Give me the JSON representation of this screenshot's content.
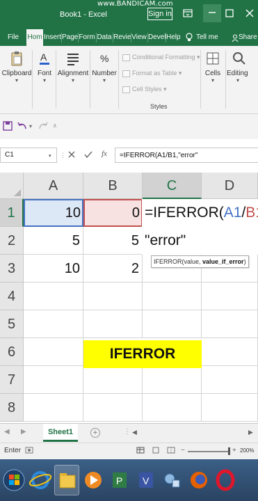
{
  "watermark": "www.BANDICAM.com",
  "window": {
    "title": "Book1 - Excel",
    "signin": "Sign in"
  },
  "tabs": [
    {
      "label": "File"
    },
    {
      "label": "Hom"
    },
    {
      "label": "Insert"
    },
    {
      "label": "Page"
    },
    {
      "label": "Form"
    },
    {
      "label": "Data"
    },
    {
      "label": "Revie"
    },
    {
      "label": "View"
    },
    {
      "label": "Devel"
    },
    {
      "label": "Help"
    }
  ],
  "tellme": "Tell me",
  "share": "Share",
  "ribbon": {
    "clipboard": "Clipboard",
    "font": "Font",
    "alignment": "Alignment",
    "number": "Number",
    "conditional_formatting": "Conditional Formatting",
    "format_as_table": "Format as Table",
    "cell_styles": "Cell Styles",
    "styles_group": "Styles",
    "cells": "Cells",
    "editing": "Editing"
  },
  "formula_bar": {
    "name_box": "C1",
    "formula": "=IFERROR(A1/B1,\"error\""
  },
  "columns": [
    "A",
    "B",
    "C",
    "D"
  ],
  "rows": [
    "1",
    "2",
    "3",
    "4",
    "5",
    "6",
    "7",
    "8"
  ],
  "cells": {
    "A1": "10",
    "B1": "0",
    "A2": "5",
    "B2": "5",
    "A3": "10",
    "B3": "2"
  },
  "editing_cell": {
    "prefix": "=IFERROR(",
    "ref1": "A1",
    "op": "/",
    "ref2": "B1",
    "comma": ",",
    "line2": "\"error\""
  },
  "tooltip": {
    "fn_sig": "IFERROR(value, ",
    "current_arg": "value_if_error",
    "close": ")"
  },
  "banner": "IFERROR",
  "sheet_tab": "Sheet1",
  "status": {
    "mode": "Enter",
    "zoom": "200%",
    "zoom_level": 1.0
  },
  "colors": {
    "excel_green": "#217346",
    "ref_blue": "#4472c4",
    "ref_red": "#c0504d",
    "banner_yellow": "#ffff00"
  }
}
